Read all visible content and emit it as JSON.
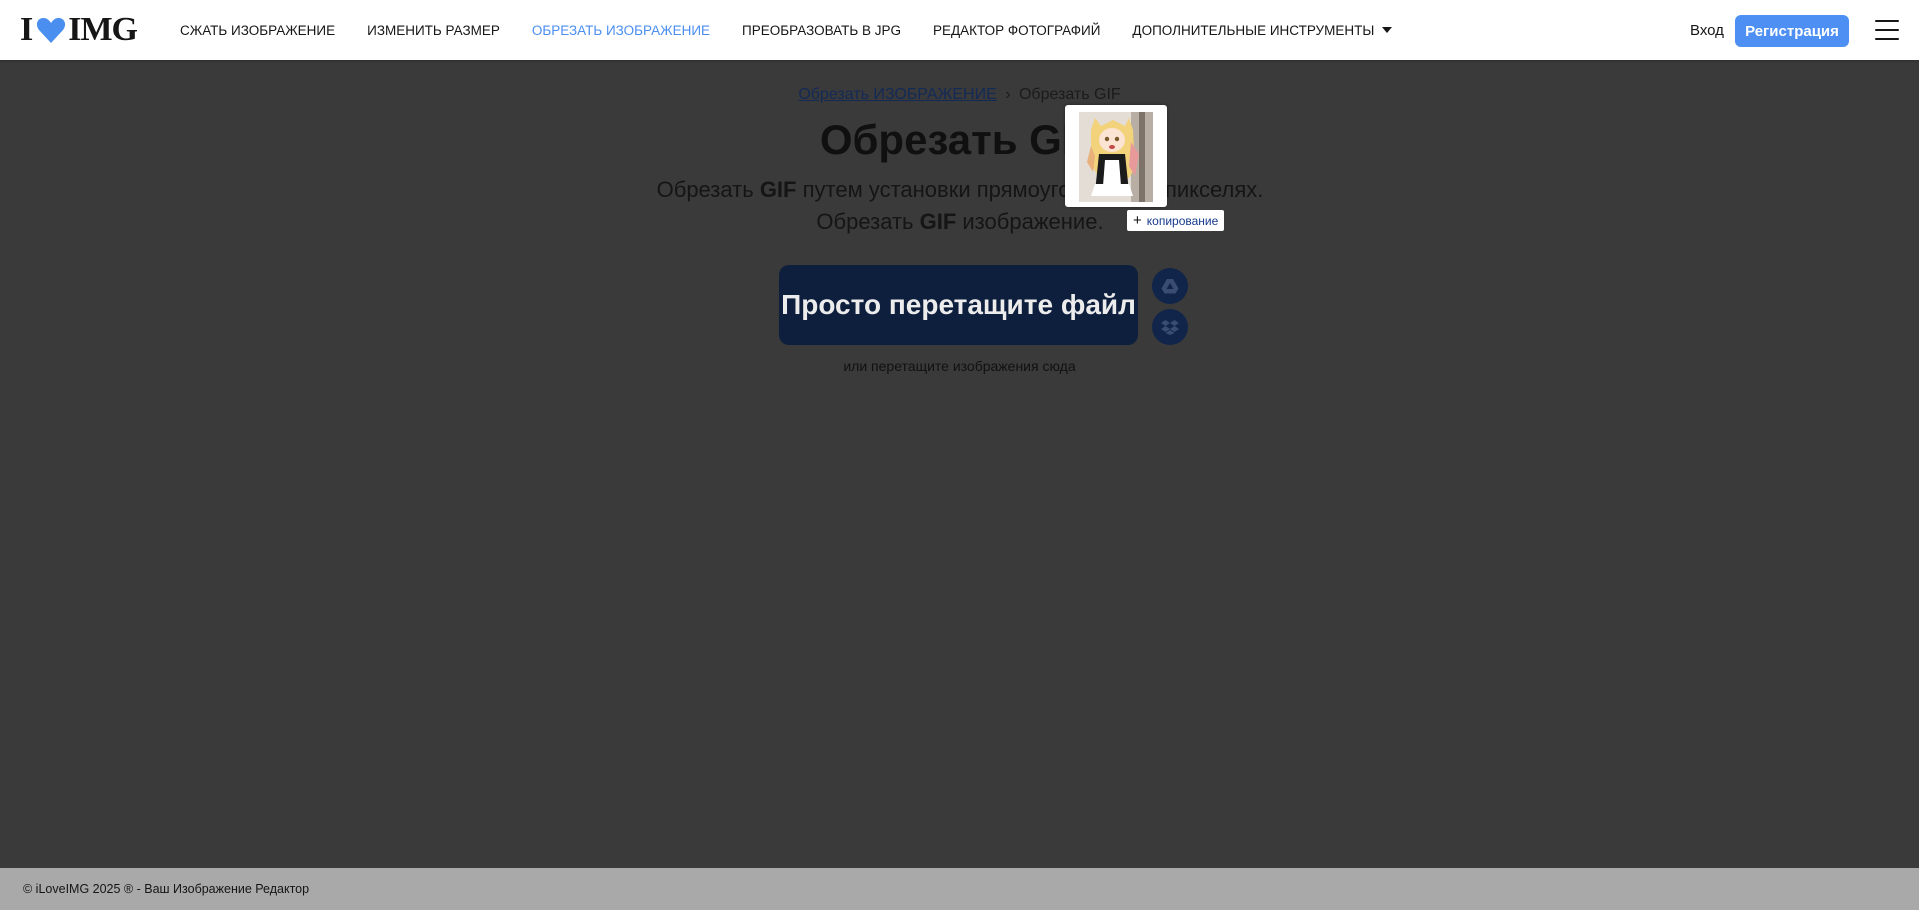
{
  "header": {
    "logo": {
      "left": "I",
      "right": "IMG",
      "heart_color": "#4a8ef0"
    },
    "nav": [
      {
        "label": "СЖАТЬ ИЗОБРАЖЕНИЕ"
      },
      {
        "label": "ИЗМЕНИТЬ РАЗМЕР"
      },
      {
        "label": "ОБРЕЗАТЬ ИЗОБРАЖЕНИЕ",
        "active": true
      },
      {
        "label": "ПРЕОБРАЗОВАТЬ В JPG"
      },
      {
        "label": "РЕДАКТОР ФОТОГРАФИЙ"
      },
      {
        "label": "ДОПОЛНИТЕЛЬНЫЕ ИНСТРУМЕНТЫ",
        "dropdown": true
      }
    ],
    "login_label": "Вход",
    "signup_label": "Регистрация",
    "menu_icon": "hamburger-icon"
  },
  "main": {
    "breadcrumb": {
      "link": "Обрезать ИЗОБРАЖЕНИЕ",
      "separator": "›",
      "current": "Обрезать GIF"
    },
    "title": "Обрезать GIF",
    "description": {
      "line1_pre": "Обрезать ",
      "line1_bold": "GIF",
      "line1_post": " путем установки прямоугольника в пикселях.",
      "line2_pre": "Обрезать ",
      "line2_bold": "GIF",
      "line2_post": " изображение."
    },
    "select_button_label": "Просто перетащите файл",
    "cloud_buttons": [
      {
        "icon": "google-drive-icon"
      },
      {
        "icon": "dropbox-icon"
      }
    ],
    "drop_hint": "или перетащите изображения сюда"
  },
  "drag_preview": {
    "thumbnail_icon": "anime-girl-thumbnail",
    "copy_label": "копирование",
    "copy_icon": "plus-icon"
  },
  "footer": {
    "text": "© iLoveIMG 2025 ® - Ваш Изображение Редактор"
  },
  "colors": {
    "accent": "#4a8ef0",
    "button_bg": "#0e1e3d",
    "overlay_bg": "#3a3a3a",
    "footer_bg": "#a9a9a9"
  }
}
